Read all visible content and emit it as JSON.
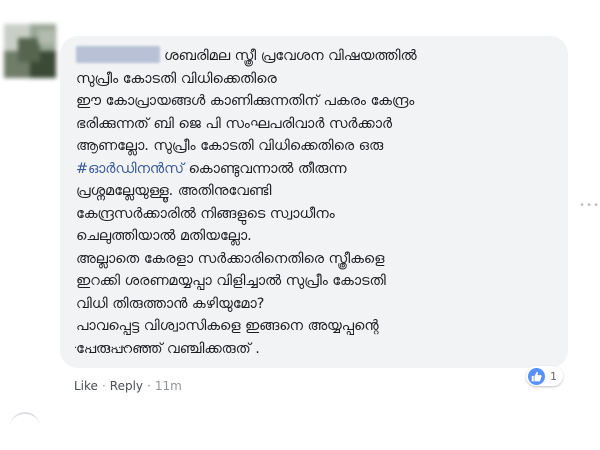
{
  "comment": {
    "lines": [
      "ശബരിമല സ്ത്രീ പ്രവേശന വിഷയത്തിൽ",
      "സുപ്രീം കോടതി വിധിക്കെതിരെ",
      "ഈ കോപ്രായങ്ങൾ കാണിക്കുന്നതിന് പകരം കേന്ദ്രം",
      "ഭരിക്കുന്നത് ബി ജെ പി സംഘപരിവാർ സർക്കാർ",
      "ആണല്ലോ. സുപ്രീം കോടതി വിധിക്കെതിരെ ഒരു",
      "കൊണ്ടുവന്നാൽ തീരുന്ന",
      "പ്രശ്നമല്ലേയുള്ളൂ. അതിനുവേണ്ടി",
      "കേന്ദ്രസർക്കാരിൽ നിങ്ങളുടെ സ്വാധീനം",
      "ചെലുത്തിയാൽ മതിയല്ലോ.",
      "അല്ലാതെ കേരളാ സർക്കാരിനെതിരെ സ്ത്രീകളെ",
      "ഇറക്കി ശരണമയ്യപ്പാ വിളിച്ചാൽ സുപ്രീം കോടതി",
      "വിധി തിരുത്താൻ കഴിയുമോ?",
      "പാവപ്പെട്ട വിശ്വാസികളെ ഇങ്ങനെ അയ്യപ്പന്റെ",
      "പേരുപറഞ്ഞ് വഞ്ചിക്കരുത് ."
    ],
    "hashtag": "#ഓർഡിനൻസ്",
    "trailing_dots": ". ..................."
  },
  "actions": {
    "like_label": "Like",
    "separator": "·",
    "reply_label": "Reply",
    "timestamp": "11m"
  },
  "reactions": {
    "icon": "thumbs-up-icon",
    "count": "1",
    "color": "#5890ff"
  },
  "colors": {
    "bubble": "#f2f3f5",
    "text": "#1c1e21",
    "meta": "#90949c",
    "hashtag": "#385898"
  }
}
